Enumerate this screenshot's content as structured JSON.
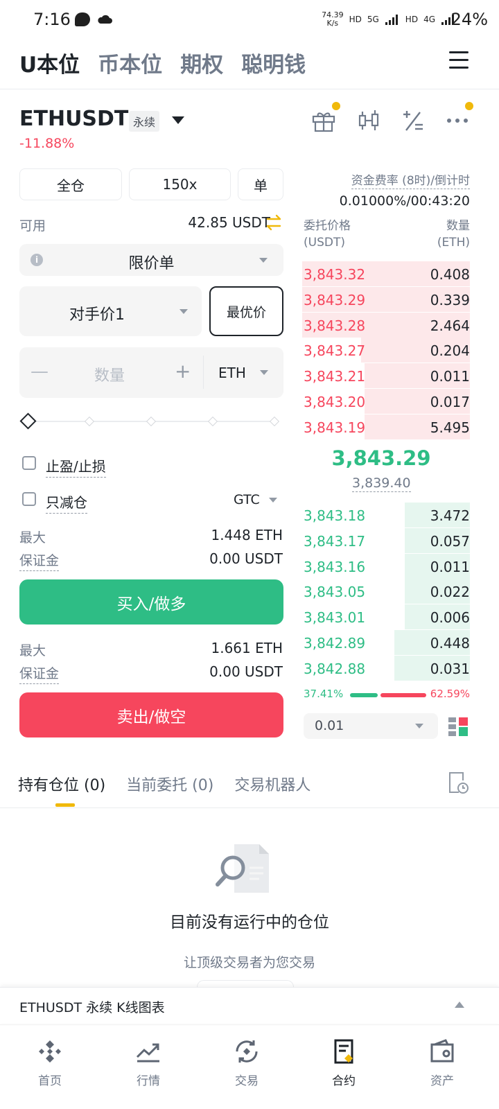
{
  "status_bar": {
    "time": "7:16",
    "net_speed_value": "74.39",
    "net_speed_unit": "K/s",
    "hd1": "HD",
    "gen1": "5G",
    "hd2": "HD",
    "gen2": "4G",
    "battery": "24%"
  },
  "top_tabs": [
    {
      "label": "U本位",
      "active": true
    },
    {
      "label": "币本位",
      "active": false
    },
    {
      "label": "期权",
      "active": false
    },
    {
      "label": "聪明钱",
      "active": false
    }
  ],
  "symbol": {
    "name": "ETHUSDT",
    "badge": "永续",
    "change": "-11.88%"
  },
  "toolbar_icons": [
    "gift-icon",
    "candlestick-icon",
    "calculator-icon",
    "more-icon"
  ],
  "order_form": {
    "margin_mode": "全仓",
    "leverage": "150x",
    "position_mode": "单",
    "available_label": "可用",
    "available_value": "42.85 USDT",
    "order_type": "限价单",
    "price_type": "对手价1",
    "best_price_label": "最优价",
    "quantity_placeholder": "数量",
    "quantity_unit": "ETH",
    "tp_sl_label": "止盈/止损",
    "reduce_only_label": "只减仓",
    "tif": "GTC",
    "buy": {
      "max_label": "最大",
      "max_value": "1.448 ETH",
      "margin_label": "保证金",
      "margin_value": "0.00 USDT",
      "button": "买入/做多"
    },
    "sell": {
      "max_label": "最大",
      "max_value": "1.661 ETH",
      "margin_label": "保证金",
      "margin_value": "0.00 USDT",
      "button": "卖出/做空"
    }
  },
  "orderbook": {
    "funding_label": "资金费率 (8时)/倒计时",
    "funding_value": "0.01000%/00:43:20",
    "price_header": "委托价格",
    "price_unit": "(USDT)",
    "qty_header": "数量",
    "qty_unit": "(ETH)",
    "asks": [
      {
        "price": "3,843.32",
        "qty": "0.408",
        "depth": 1.0
      },
      {
        "price": "3,843.29",
        "qty": "0.339",
        "depth": 1.0
      },
      {
        "price": "3,843.28",
        "qty": "2.464",
        "depth": 1.0
      },
      {
        "price": "3,843.27",
        "qty": "0.204",
        "depth": 0.65
      },
      {
        "price": "3,843.21",
        "qty": "0.011",
        "depth": 0.63
      },
      {
        "price": "3,843.20",
        "qty": "0.017",
        "depth": 0.63
      },
      {
        "price": "3,843.19",
        "qty": "5.495",
        "depth": 0.63
      }
    ],
    "last_price": "3,843.29",
    "mark_price": "3,839.40",
    "bids": [
      {
        "price": "3,843.18",
        "qty": "3.472",
        "depth": 0.39
      },
      {
        "price": "3,843.17",
        "qty": "0.057",
        "depth": 0.39
      },
      {
        "price": "3,843.16",
        "qty": "0.011",
        "depth": 0.39
      },
      {
        "price": "3,843.05",
        "qty": "0.022",
        "depth": 0.39
      },
      {
        "price": "3,843.01",
        "qty": "0.006",
        "depth": 0.39
      },
      {
        "price": "3,842.89",
        "qty": "0.448",
        "depth": 0.45
      },
      {
        "price": "3,842.88",
        "qty": "0.031",
        "depth": 0.45
      }
    ],
    "buy_ratio": "37.41%",
    "sell_ratio": "62.59%",
    "buy_ratio_value": 37.41,
    "precision": "0.01"
  },
  "positions": {
    "tabs": [
      {
        "label": "持有仓位 (0)",
        "active": true
      },
      {
        "label": "当前委托 (0)",
        "active": false
      },
      {
        "label": "交易机器人",
        "active": false
      }
    ],
    "empty_title": "目前没有运行中的仓位",
    "empty_subtitle": "让顶级交易者为您交易"
  },
  "kline_bar": {
    "label": "ETHUSDT 永续 K线图表"
  },
  "bottom_nav": [
    {
      "label": "首页",
      "icon": "home-icon",
      "active": false
    },
    {
      "label": "行情",
      "icon": "markets-icon",
      "active": false
    },
    {
      "label": "交易",
      "icon": "trade-icon",
      "active": false
    },
    {
      "label": "合约",
      "icon": "futures-icon",
      "active": true
    },
    {
      "label": "资产",
      "icon": "wallet-icon",
      "active": false
    }
  ],
  "colors": {
    "green": "#2ebd85",
    "red": "#f6465d",
    "yellow": "#f0b90b",
    "text": "#1e2329",
    "muted": "#707a8a"
  }
}
